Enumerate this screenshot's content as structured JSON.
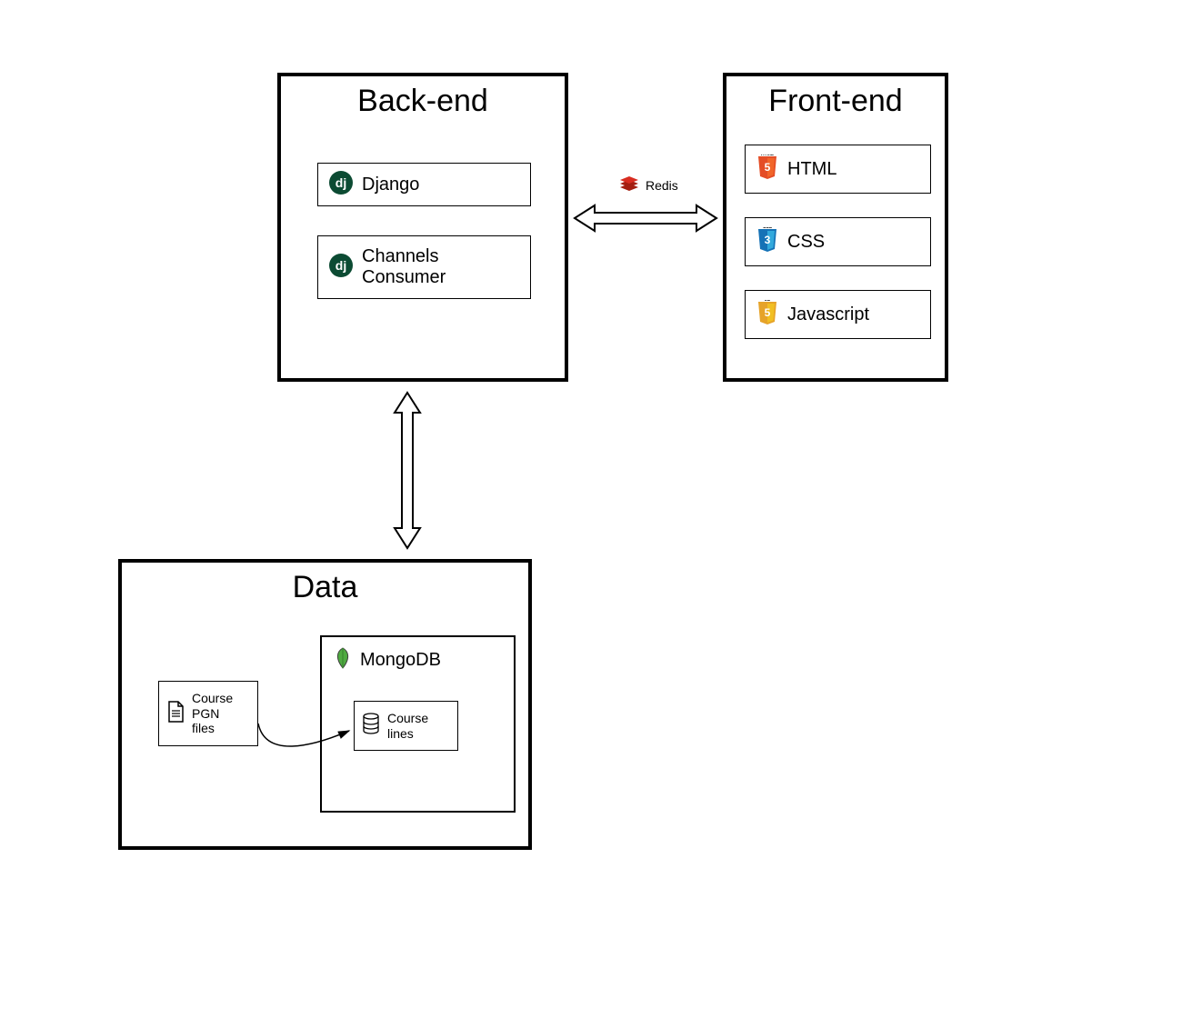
{
  "backend": {
    "title": "Back-end",
    "items": [
      {
        "label": "Django",
        "icon": "django"
      },
      {
        "label": "Channels\nConsumer",
        "icon": "django"
      }
    ]
  },
  "frontend": {
    "title": "Front-end",
    "items": [
      {
        "label": "HTML",
        "icon": "html"
      },
      {
        "label": "CSS",
        "icon": "css"
      },
      {
        "label": "Javascript",
        "icon": "js"
      }
    ]
  },
  "data": {
    "title": "Data",
    "pgn": {
      "label": "Course\nPGN\nfiles",
      "icon": "file"
    },
    "mongo": {
      "label": "MongoDB",
      "icon": "mongo"
    },
    "lines": {
      "label": "Course\nlines",
      "icon": "db"
    }
  },
  "connector": {
    "redis_label": "Redis"
  }
}
